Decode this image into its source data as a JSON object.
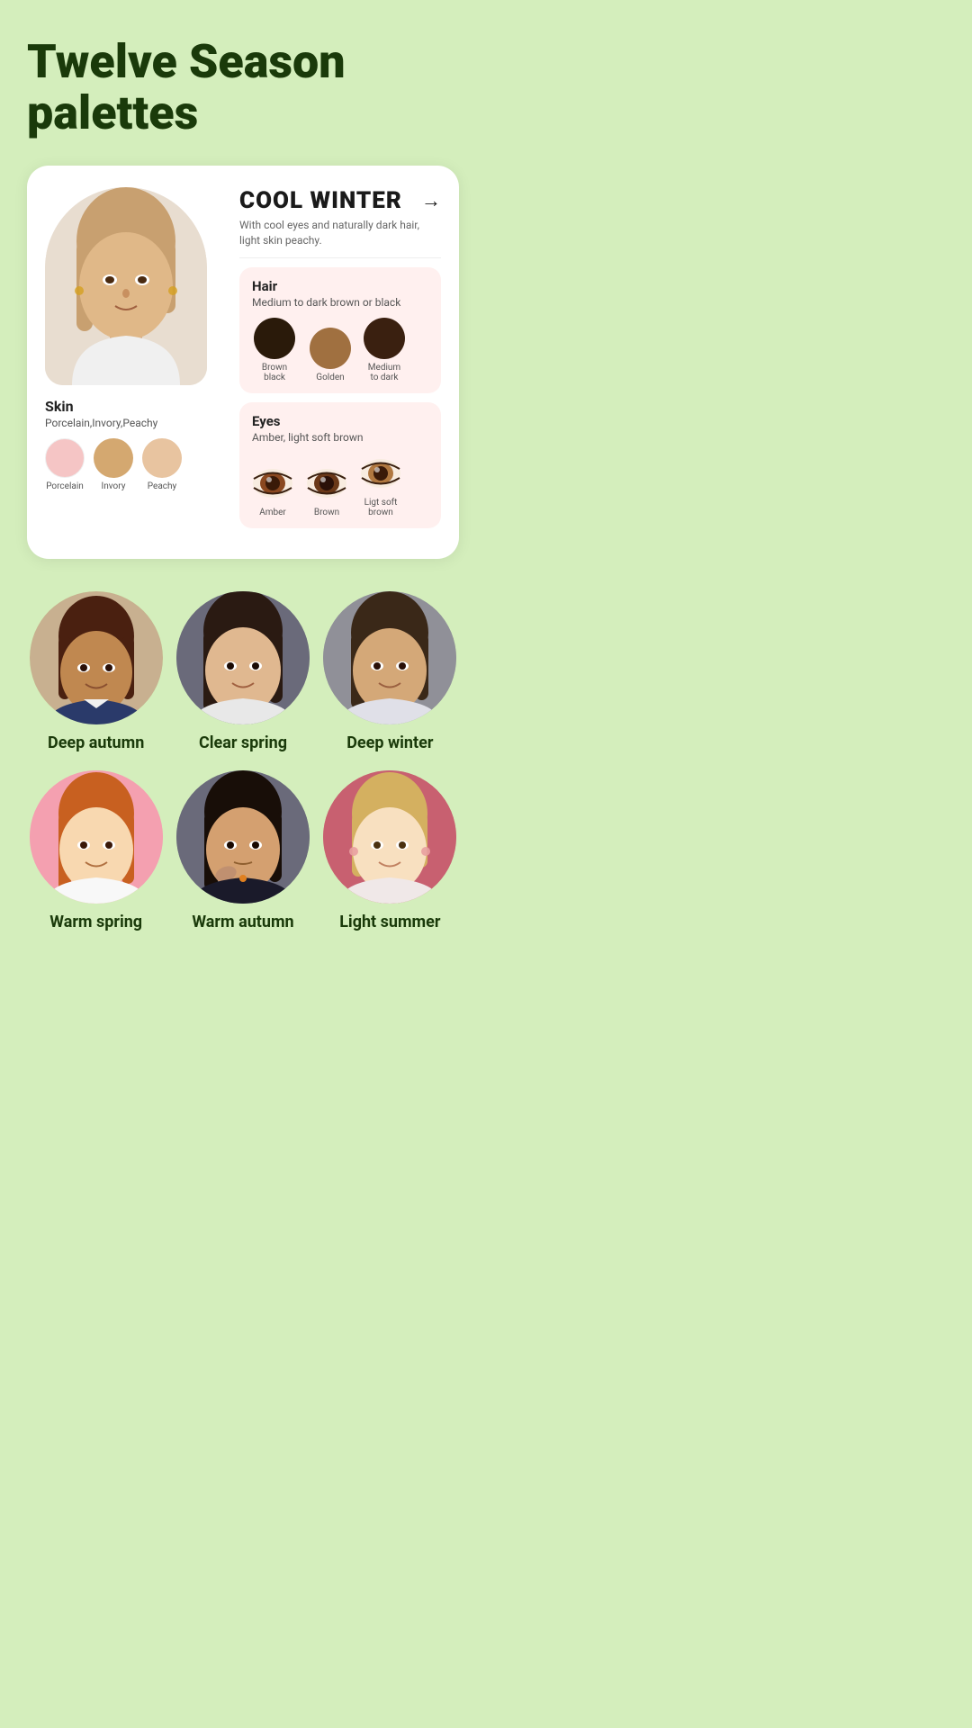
{
  "page": {
    "title": "Twelve Season\npalettes"
  },
  "card": {
    "season_name": "COOL WINTER",
    "season_desc": "With cool eyes and naturally dark hair, light skin peachy.",
    "arrow": "→",
    "skin": {
      "title": "Skin",
      "subtitle": "Porcelain,Invory,Peachy",
      "swatches": [
        {
          "color": "#f5c5c5",
          "label": "Porcelain"
        },
        {
          "color": "#d4a870",
          "label": "Invory"
        },
        {
          "color": "#e8c4a0",
          "label": "Peachy"
        }
      ]
    },
    "hair": {
      "title": "Hair",
      "subtitle": "Medium to dark brown or black",
      "swatches": [
        {
          "color": "#2a1a0a",
          "label": "Brown black"
        },
        {
          "color": "#a07040",
          "label": "Golden"
        },
        {
          "color": "#3a2010",
          "label": "Medium\nto dark"
        }
      ]
    },
    "eyes": {
      "title": "Eyes",
      "subtitle": "Amber, light soft brown",
      "swatches": [
        {
          "color": "#8a4820",
          "label": "Amber"
        },
        {
          "color": "#6a3818",
          "label": "Brown"
        },
        {
          "color": "#b07840",
          "label": "Ligt soft\nbrown"
        }
      ]
    }
  },
  "seasons": [
    {
      "row": 1,
      "items": [
        {
          "label": "Deep autumn",
          "bg": "#c8b090",
          "skin": "dark"
        },
        {
          "label": "Clear spring",
          "bg": "#7a7a8a",
          "skin": "medium"
        },
        {
          "label": "Deep winter",
          "bg": "#8a8a9a",
          "skin": "medium-dark"
        }
      ]
    },
    {
      "row": 2,
      "items": [
        {
          "label": "Warm spring",
          "bg": "#f4a0b0",
          "skin": "light"
        },
        {
          "label": "Warm autumn",
          "bg": "#6a6a7a",
          "skin": "dark"
        },
        {
          "label": "Light summer",
          "bg": "#c86070",
          "skin": "light-blonde"
        }
      ]
    }
  ]
}
